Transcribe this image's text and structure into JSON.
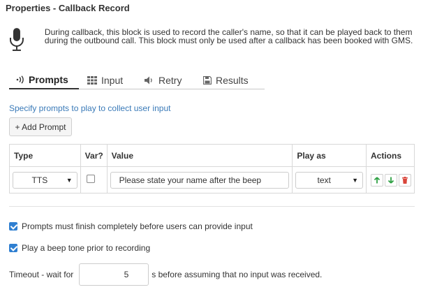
{
  "title": "Properties - Callback Record",
  "description": "During callback, this block is used to record the caller's name, so that it can be played back to them during the outbound call. This block must only be used after a callback has been booked with GMS.",
  "tabs": [
    {
      "label": "Prompts",
      "icon": "sound-wave-icon",
      "active": true
    },
    {
      "label": "Input",
      "icon": "grid-icon",
      "active": false
    },
    {
      "label": "Retry",
      "icon": "speaker-icon",
      "active": false
    },
    {
      "label": "Results",
      "icon": "save-icon",
      "active": false
    }
  ],
  "prompts_section": {
    "instruction": "Specify prompts to play to collect user input",
    "add_button": "+ Add Prompt",
    "columns": [
      "Type",
      "Var?",
      "Value",
      "Play as",
      "Actions"
    ],
    "rows": [
      {
        "type": "TTS",
        "var": false,
        "value": "Please state your name after the beep",
        "play_as": "text"
      }
    ]
  },
  "options": {
    "prompts_finish": {
      "label": "Prompts must finish completely before users can provide input",
      "checked": true
    },
    "beep_tone": {
      "label": "Play a beep tone prior to recording",
      "checked": true
    }
  },
  "timeout": {
    "prefix": "Timeout - wait for",
    "value": "5",
    "suffix": "s before assuming that no input was received."
  },
  "colors": {
    "accent": "#3a7ab8",
    "checkbox": "#2f7fd1",
    "up": "#2ea043",
    "down": "#2ea043",
    "delete": "#d9453a"
  }
}
